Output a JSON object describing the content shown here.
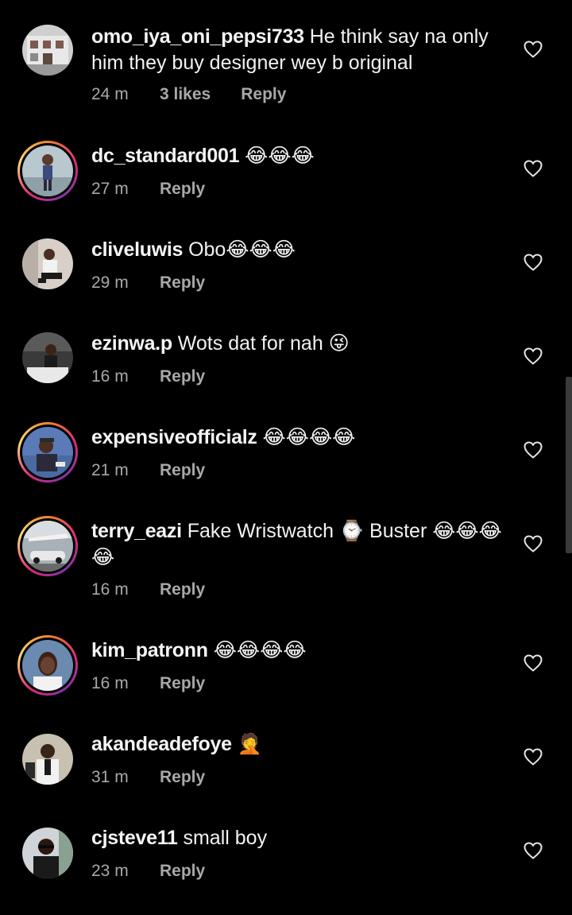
{
  "comments": [
    {
      "username": "omo_iya_oni_pepsi733",
      "text": "He think say na only him they buy designer wey b original",
      "time": "24 m",
      "likes": "3 likes",
      "reply": "Reply",
      "avatar_story_ring": false
    },
    {
      "username": "dc_standard001",
      "text": "😂😂😂",
      "time": "27 m",
      "reply": "Reply",
      "avatar_story_ring": true
    },
    {
      "username": "cliveluwis",
      "text": "Obo😂😂😂",
      "time": "29 m",
      "reply": "Reply",
      "avatar_story_ring": false
    },
    {
      "username": "ezinwa.p",
      "text": "Wots dat for nah 😜",
      "time": "16 m",
      "reply": "Reply",
      "avatar_story_ring": false
    },
    {
      "username": "expensiveofficialz",
      "text": "😂😂😂😂",
      "time": "21 m",
      "reply": "Reply",
      "avatar_story_ring": true
    },
    {
      "username": "terry_eazi",
      "text": "Fake Wristwatch ⌚ Buster 😂😂😂😂",
      "time": "16 m",
      "reply": "Reply",
      "avatar_story_ring": true
    },
    {
      "username": "kim_patronn",
      "text": "😂😂😂😂",
      "time": "16 m",
      "reply": "Reply",
      "avatar_story_ring": true
    },
    {
      "username": "akandeadefoye",
      "text": "🤦",
      "time": "31 m",
      "reply": "Reply",
      "avatar_story_ring": false
    },
    {
      "username": "cjsteve11",
      "text": "small boy",
      "time": "23 m",
      "reply": "Reply",
      "avatar_story_ring": false
    }
  ],
  "icons": {
    "like": "heart-outline-icon"
  },
  "colors": {
    "background": "#000000",
    "text": "#f2f2f2",
    "secondary_text": "#a8a8a8",
    "story_ring_start": "#f58529",
    "story_ring_end": "#dd2a7b"
  }
}
